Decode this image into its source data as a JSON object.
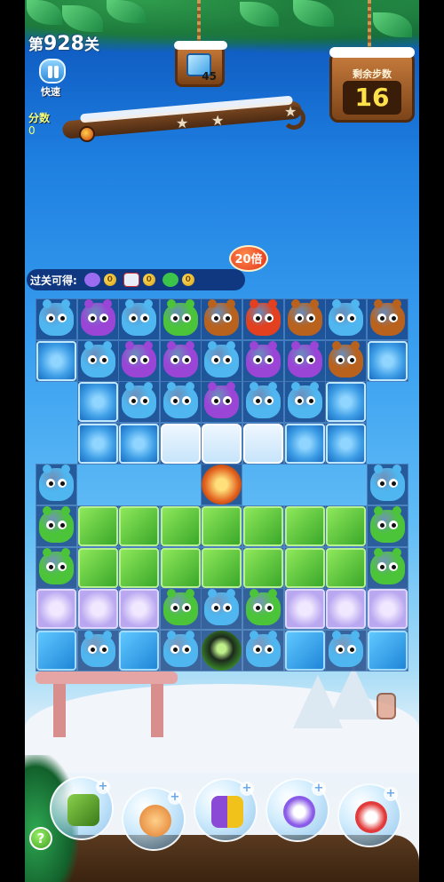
{
  "header": {
    "level_prefix": "第",
    "level_number": "928",
    "level_suffix": "关",
    "speed_label": "快速",
    "score_label": "分数",
    "score_value": "0",
    "goal_count": "45",
    "moves_title": "剩余步数",
    "moves_value": "16"
  },
  "collect": {
    "label": "过关可得:",
    "multiplier": "20倍",
    "items": [
      {
        "icon": "candy-icon",
        "count": "0",
        "color": "#9b6cf0"
      },
      {
        "icon": "ticket-icon",
        "count": "0",
        "color": "#e8eef8"
      },
      {
        "icon": "clover-icon",
        "count": "0",
        "color": "#3cc44a"
      }
    ]
  },
  "colors": {
    "blue": "#4fb6ef",
    "purple": "#9a45d6",
    "green": "#4cc43a",
    "brown": "#b8621e",
    "red": "#e2401e"
  },
  "board": {
    "rows": [
      [
        "blue",
        "purple",
        "blue",
        "green",
        "brown",
        "red",
        "brown",
        "blue",
        "brown"
      ],
      [
        "ice-flower",
        "blue",
        "purple",
        "purple",
        "blue",
        "purple",
        "purple",
        "brown",
        "ice-flower"
      ],
      [
        null,
        "ice-flower",
        "blue",
        "blue",
        "purple",
        "blue",
        "blue",
        "ice-flower",
        null
      ],
      [
        null,
        "ice-flower",
        "ice-flower",
        "empty-ice",
        "empty-ice",
        "empty-ice",
        "ice-flower",
        "ice-flower",
        null
      ],
      [
        "blue",
        null,
        null,
        null,
        "owl-special",
        null,
        null,
        null,
        "blue"
      ],
      [
        "green",
        "leaf",
        "leaf",
        "leaf",
        "leaf",
        "leaf",
        "leaf",
        "leaf",
        "green"
      ],
      [
        "green",
        "leaf",
        "leaf",
        "leaf",
        "leaf",
        "leaf",
        "leaf",
        "leaf",
        "green"
      ],
      [
        "lilac",
        "lilac",
        "lilac",
        "green",
        "blue",
        "green",
        "lilac",
        "lilac",
        "lilac"
      ],
      [
        "water",
        "blue",
        "water",
        "blue",
        "robot",
        "blue",
        "water",
        "blue",
        "water"
      ]
    ]
  },
  "boosters": [
    {
      "name": "shuffle-booster",
      "icon": "shuffle-icon",
      "color": "#5a8a2a"
    },
    {
      "name": "clock-booster",
      "icon": "clock-icon",
      "color": "#e48a3a"
    },
    {
      "name": "swap-booster",
      "icon": "swap-icon",
      "color": "#8a4ad6"
    },
    {
      "name": "horizontal-rocket-booster",
      "icon": "rocket-icon",
      "color": "#8a5ae8"
    },
    {
      "name": "vertical-rocket-booster",
      "icon": "rocket-icon",
      "color": "#e23a3a"
    }
  ],
  "help_label": "?"
}
